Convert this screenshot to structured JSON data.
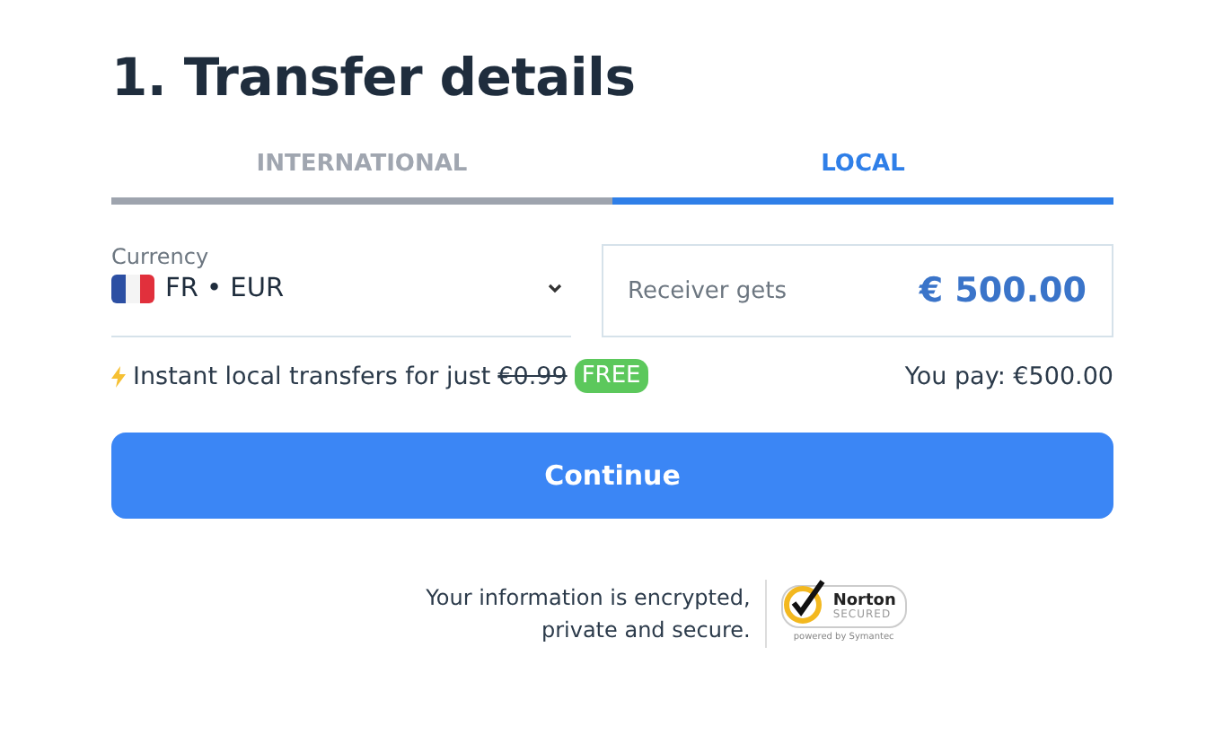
{
  "title": "1. Transfer details",
  "tabs": [
    {
      "label": "INTERNATIONAL",
      "selected": false
    },
    {
      "label": "LOCAL",
      "selected": true
    }
  ],
  "currency": {
    "label": "Currency",
    "value": "FR • EUR"
  },
  "receiver": {
    "label": "Receiver gets",
    "amount": "€ 500.00"
  },
  "promo": {
    "text": "Instant local transfers for just",
    "old_price": "€0.99",
    "badge": "FREE"
  },
  "you_pay": "You pay: €500.00",
  "continue_button": "Continue",
  "footer": {
    "lines": [
      "Your information is encrypted,",
      "private and secure."
    ],
    "seal": {
      "name": "Norton",
      "status": "SECURED",
      "powered_by": "powered by Symantec"
    }
  }
}
